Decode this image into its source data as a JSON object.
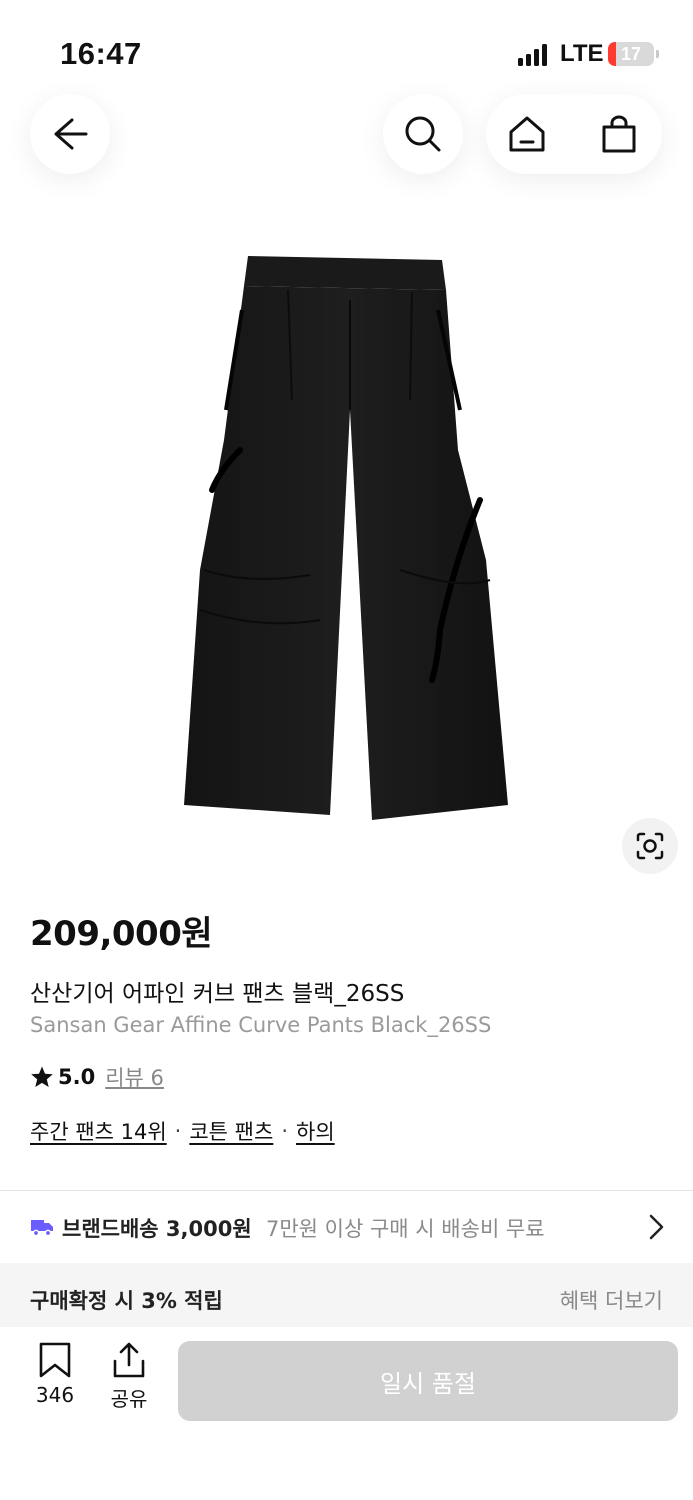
{
  "status_bar": {
    "time": "16:47",
    "network": "LTE",
    "battery_level": "17",
    "battery_fraction": 0.17,
    "battery_color": "#ff3b30"
  },
  "top_nav": {
    "back_icon": "arrow-left-icon",
    "search_icon": "search-icon",
    "home_icon": "home-icon",
    "cart_icon": "shopping-bag-icon"
  },
  "product": {
    "image_alt": "black-curve-pants-photo",
    "price": "209,000원",
    "name_ko": "산산기어 어파인 커브 팬츠 블랙_26SS",
    "name_en": "Sansan Gear Affine Curve Pants Black_26SS",
    "rating": "5.0",
    "review_label": "리뷰 6",
    "ranking": {
      "weekly_rank": "주간 팬츠 14위",
      "category_1": "코튼 팬츠",
      "category_2": "하의",
      "separator": "·"
    }
  },
  "shipping": {
    "label": "브랜드배송 3,000원",
    "note": "7만원 이상 구매 시 배송비 무료",
    "icon": "truck-icon",
    "icon_color": "#6b5cff"
  },
  "benefit": {
    "label": "구매확정 시 3% 적립",
    "more": "혜택 더보기"
  },
  "bottom_bar": {
    "bookmark_count": "346",
    "share_label": "공유",
    "soldout_label": "일시 품절"
  }
}
